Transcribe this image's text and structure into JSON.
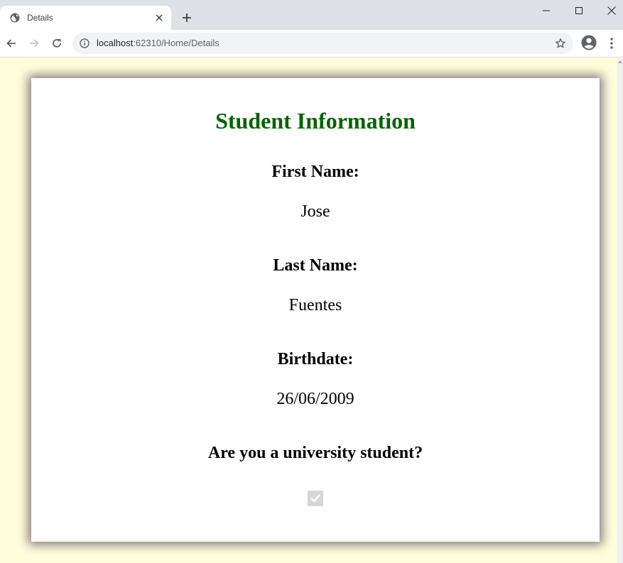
{
  "browser": {
    "tab_title": "Details",
    "url_host": "localhost",
    "url_path": ":62310/Home/Details"
  },
  "icons": {
    "favicon": "globe-icon",
    "tab_close": "close-icon",
    "new_tab": "plus-icon",
    "back": "arrow-left-icon",
    "forward": "arrow-right-icon",
    "reload": "reload-icon",
    "site_info": "info-icon",
    "bookmark": "star-icon",
    "profile": "account-icon",
    "menu": "more-vertical-icon"
  },
  "page": {
    "title": "Student Information",
    "fields": [
      {
        "label": "First Name:",
        "value": "Jose"
      },
      {
        "label": "Last Name:",
        "value": "Fuentes"
      },
      {
        "label": "Birthdate:",
        "value": "26/06/2009"
      },
      {
        "label": "Are you a university student?",
        "checked": true,
        "disabled": true
      }
    ]
  },
  "colors": {
    "page_background": "#ffffdb",
    "title": "#006400",
    "card_shadow": "#55465a"
  }
}
